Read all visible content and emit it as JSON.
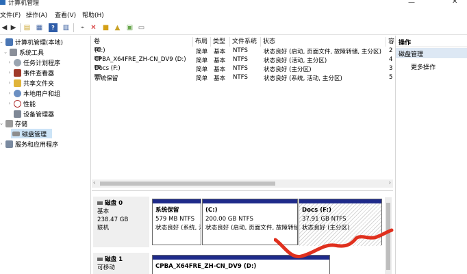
{
  "window": {
    "title": "计算机管理"
  },
  "menu": {
    "items": [
      "文件(F)",
      "操作(A)",
      "查看(V)",
      "帮助(H)"
    ]
  },
  "tree": {
    "root": "计算机管理(本地)",
    "system_tools": "系统工具",
    "task_scheduler": "任务计划程序",
    "event_viewer": "事件查看器",
    "shared_folders": "共享文件夹",
    "local_users": "本地用户和组",
    "performance": "性能",
    "device_manager": "设备管理器",
    "storage": "存储",
    "disk_management": "磁盘管理",
    "services": "服务和应用程序"
  },
  "volumes": {
    "headers": {
      "volume": "卷",
      "layout": "布局",
      "type": "类型",
      "fs": "文件系统",
      "status": "状态",
      "extra": "容"
    },
    "rows": [
      {
        "name": "(C:)",
        "layout": "简单",
        "type": "基本",
        "fs": "NTFS",
        "status": "状态良好 (启动, 页面文件, 故障转储, 主分区)",
        "extra": "2"
      },
      {
        "name": "CPBA_X64FRE_ZH-CN_DV9 (D:)",
        "layout": "简单",
        "type": "基本",
        "fs": "NTFS",
        "status": "状态良好 (活动, 主分区)",
        "extra": "4"
      },
      {
        "name": "Docs (F:)",
        "layout": "简单",
        "type": "基本",
        "fs": "NTFS",
        "status": "状态良好 (主分区)",
        "extra": "3"
      },
      {
        "name": "系统保留",
        "layout": "简单",
        "type": "基本",
        "fs": "NTFS",
        "status": "状态良好 (系统, 活动, 主分区)",
        "extra": "5"
      }
    ]
  },
  "disks": {
    "disk0": {
      "name": "磁盘 0",
      "type": "基本",
      "size": "238.47 GB",
      "state": "联机",
      "partitions": [
        {
          "name": "系统保留",
          "size": "579 MB NTFS",
          "status": "状态良好 (系统, 活动, 主分区)"
        },
        {
          "name": "(C:)",
          "size": "200.00 GB NTFS",
          "status": "状态良好 (启动, 页面文件, 故障转储"
        },
        {
          "name": "Docs (F:)",
          "size": "37.91 GB NTFS",
          "status": "状态良好 (主分区)"
        }
      ]
    },
    "disk1": {
      "name": "磁盘 1",
      "type": "可移动",
      "partition": {
        "name": "CPBA_X64FRE_ZH-CN_DV9 (D:)"
      }
    }
  },
  "actions": {
    "header": "操作",
    "section": "磁盘管理",
    "more": "更多操作"
  },
  "colors": {
    "partition_bar": "#1e2a8a",
    "selection": "#cce4f7",
    "annotation": "#e0301e"
  }
}
